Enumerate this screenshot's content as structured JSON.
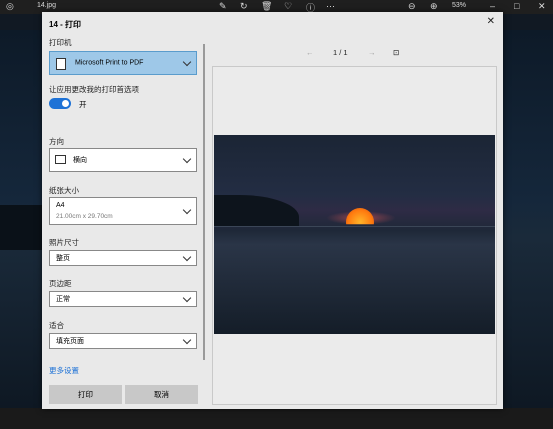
{
  "viewer": {
    "filename": "14.jpg",
    "zoom": "53%"
  },
  "dialog": {
    "title": "14 - 打印",
    "printer_label": "打印机",
    "printer_value": "Microsoft Print to PDF",
    "pref_label": "让应用更改我的打印首选项",
    "toggle_label": "开",
    "orientation_label": "方向",
    "orientation_value": "横向",
    "paper_label": "纸张大小",
    "paper_value": "A4",
    "paper_dims": "21.00cm x 29.70cm",
    "photo_size_label": "照片尺寸",
    "photo_size_value": "整页",
    "margins_label": "页边距",
    "margins_value": "正常",
    "fit_label": "适合",
    "fit_value": "填充页面",
    "more_settings": "更多设置",
    "print_button": "打印",
    "cancel_button": "取消",
    "page_indicator": "1 / 1"
  }
}
